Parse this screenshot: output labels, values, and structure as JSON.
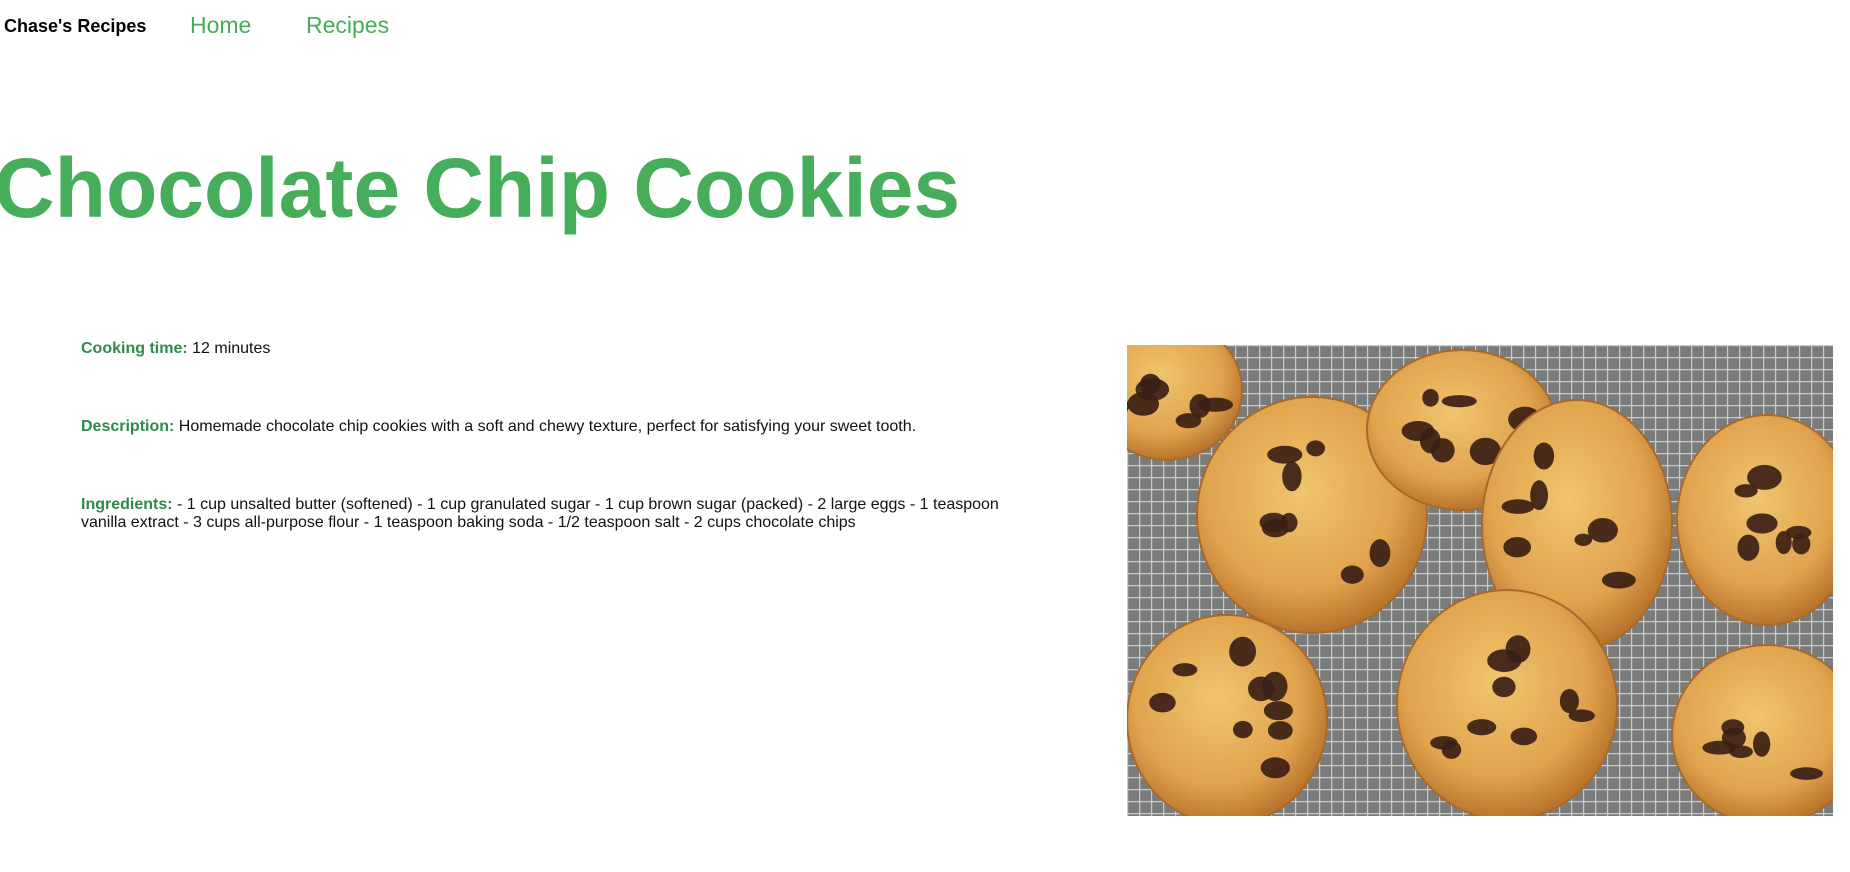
{
  "nav": {
    "brand": "Chase's Recipes",
    "links": [
      {
        "label": "Home"
      },
      {
        "label": "Recipes"
      }
    ]
  },
  "recipe": {
    "title": "Chocolate Chip Cookies",
    "cooking_time": {
      "label": "Cooking time:",
      "value": "12 minutes"
    },
    "description": {
      "label": "Description:",
      "value": "Homemade chocolate chip cookies with a soft and chewy texture, perfect for satisfying your sweet tooth."
    },
    "ingredients": {
      "label": "Ingredients:",
      "value": "- 1 cup unsalted butter (softened) - 1 cup granulated sugar - 1 cup brown sugar (packed) - 2 large eggs - 1 teaspoon vanilla extract - 3 cups all-purpose flour - 1 teaspoon baking soda - 1/2 teaspoon salt - 2 cups chocolate chips"
    }
  },
  "colors": {
    "accent": "#46ad5a",
    "label": "#2e8a4c",
    "text": "#111111",
    "cookie": "#e3a954",
    "chocolate": "#3b2015",
    "rack": "#8a8c8b"
  }
}
